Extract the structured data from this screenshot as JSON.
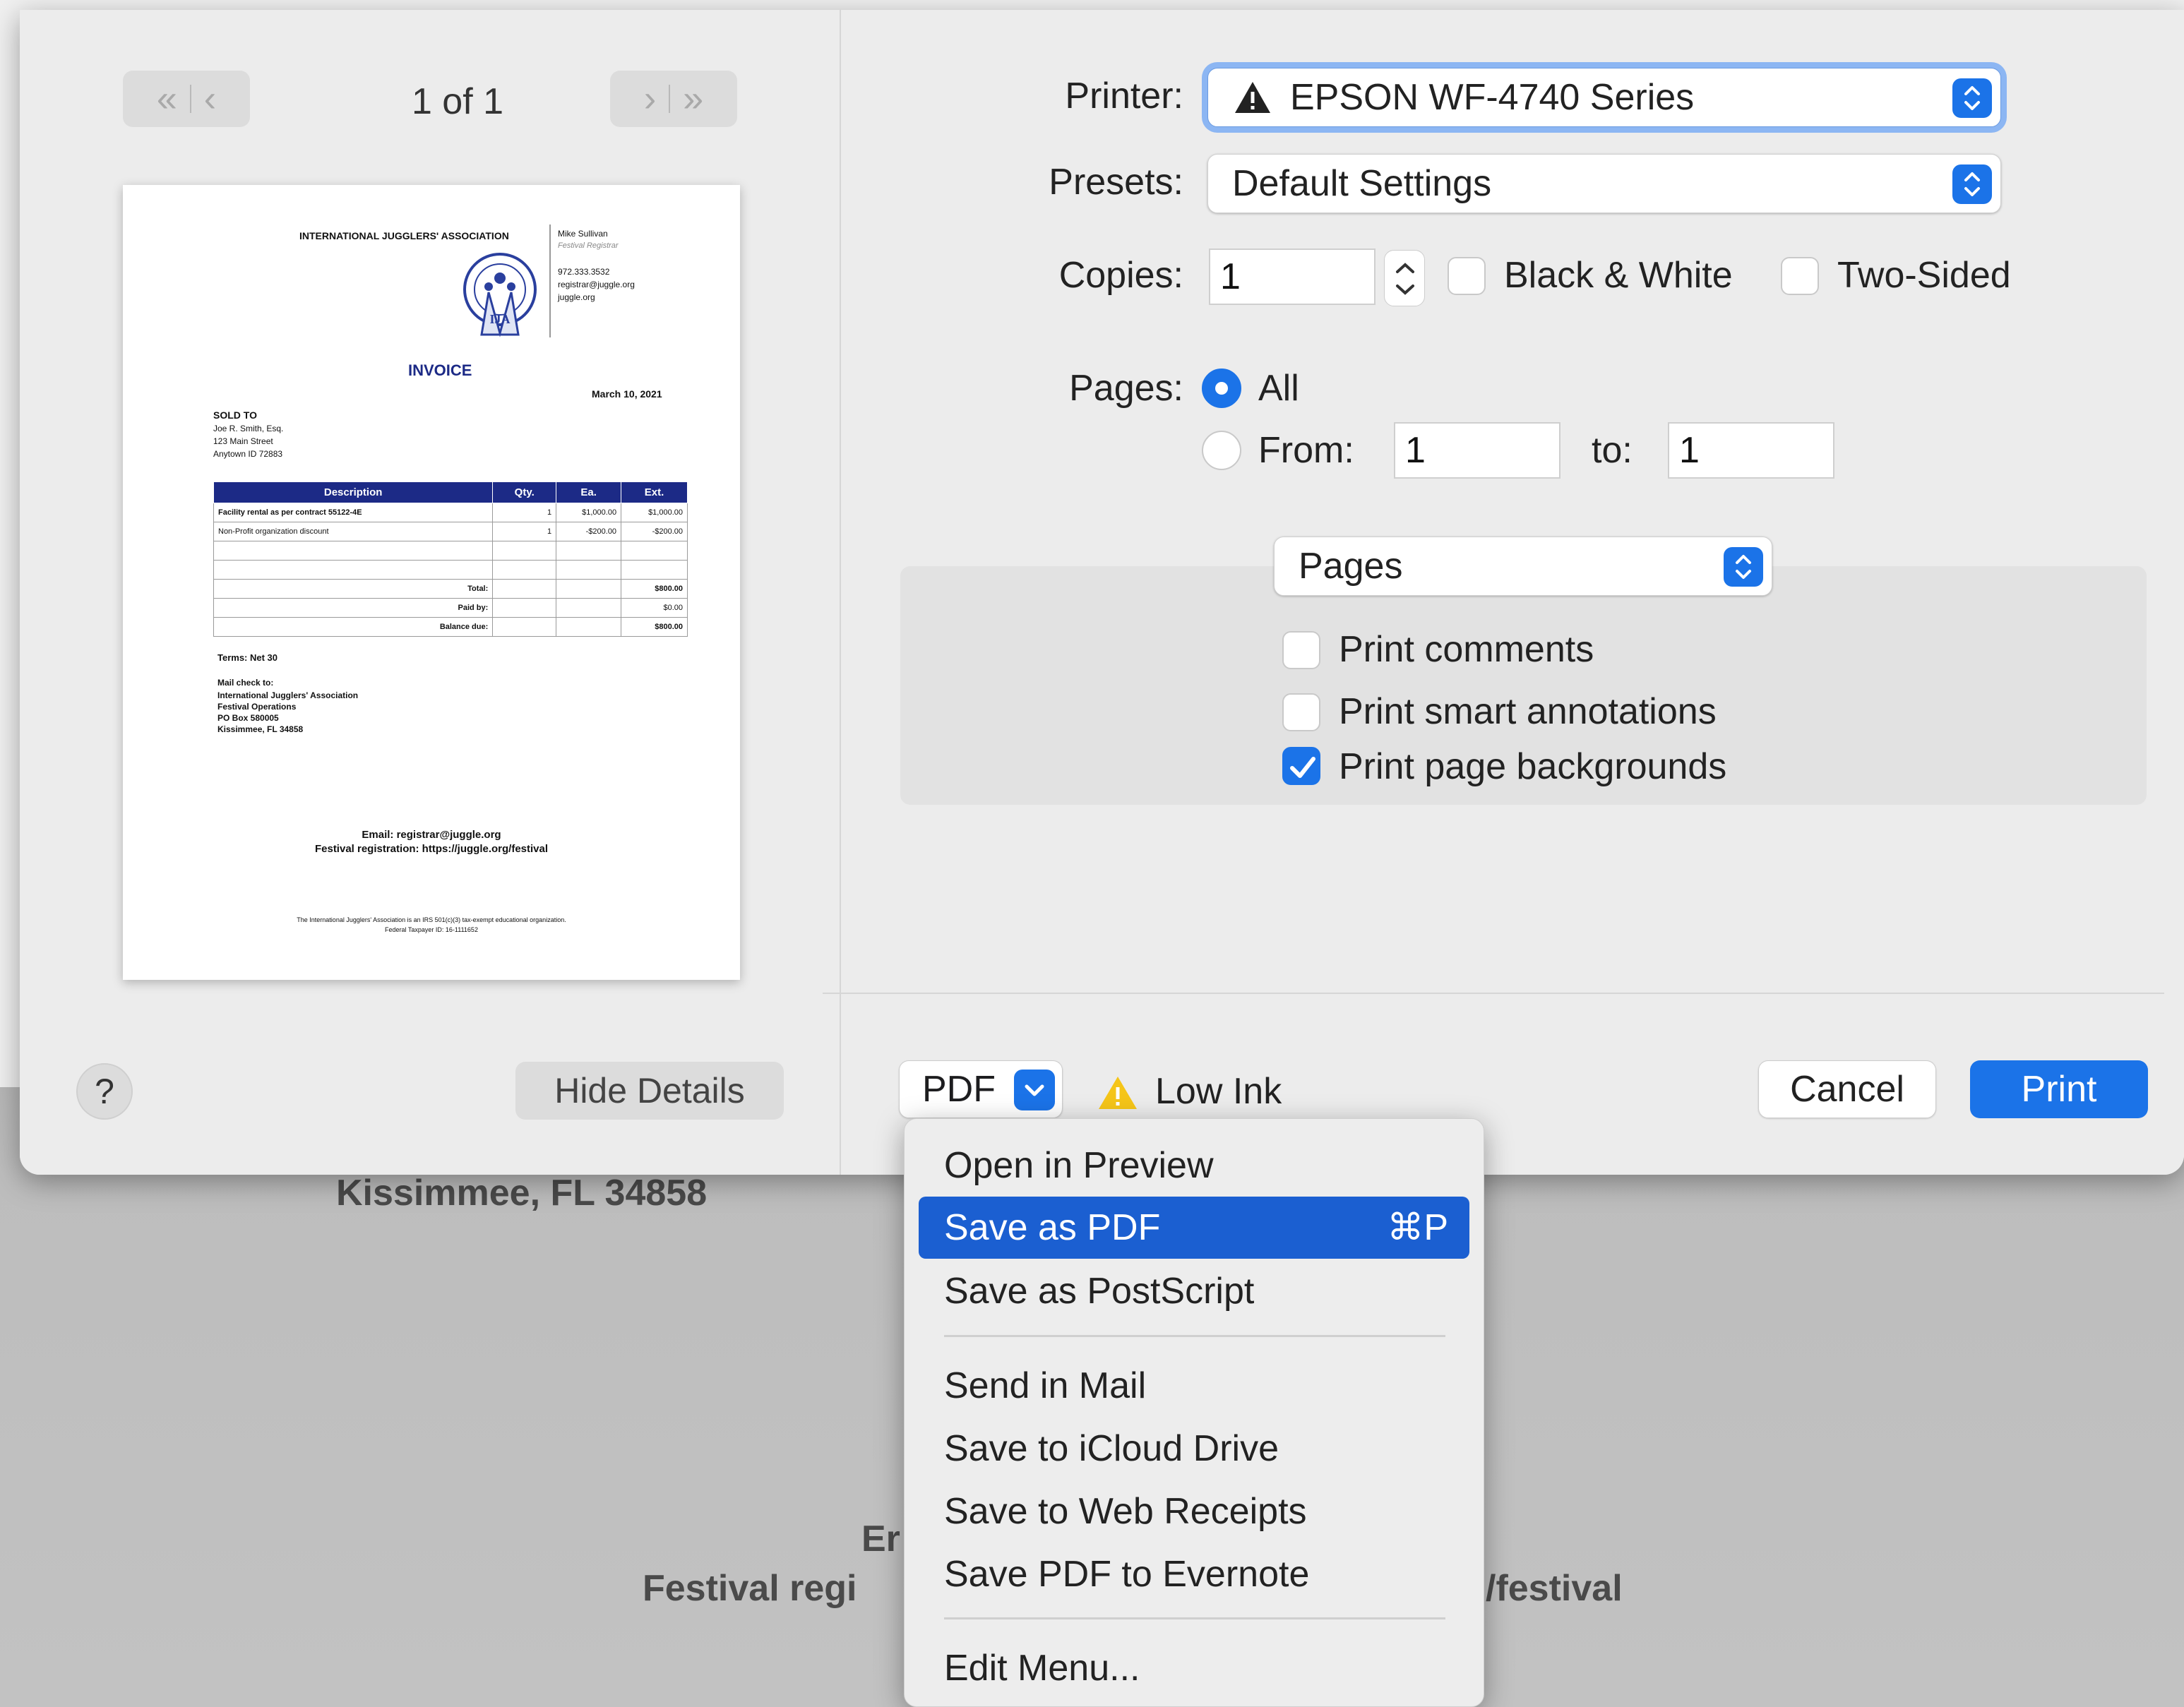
{
  "background_doc": {
    "city_line": "Kissimmee,   FL       34858",
    "email_fragment": "Er",
    "reg_fragment_left": "Festival regi",
    "reg_fragment_right": "/festival"
  },
  "preview": {
    "page_label": "1 of 1",
    "org_name": "INTERNATIONAL JUGGLERS' ASSOCIATION",
    "contact_name": "Mike Sullivan",
    "contact_title": "Festival Registrar",
    "contact_phone": "972.333.3532",
    "contact_email": "registrar@juggle.org",
    "contact_web": "juggle.org",
    "logo_text": "IJA",
    "invoice_title": "INVOICE",
    "date": "March 10, 2021",
    "sold_to_label": "SOLD TO",
    "sold_to_name": "Joe R. Smith, Esq.",
    "sold_to_street": "123 Main Street",
    "sold_to_city": "Anytown     ID     72883",
    "table_headers": [
      "Description",
      "Qty.",
      "Ea.",
      "Ext."
    ],
    "table_rows": [
      {
        "desc": "Facility rental as per contract 55122-4E",
        "qty": "1",
        "ea": "$1,000.00",
        "ext": "$1,000.00"
      },
      {
        "desc": "Non-Profit organization discount",
        "qty": "1",
        "ea": "-$200.00",
        "ext": "-$200.00"
      }
    ],
    "total_label": "Total:",
    "total_value": "$800.00",
    "paid_label": "Paid by:",
    "paid_value": "$0.00",
    "balance_label": "Balance due:",
    "balance_value": "$800.00",
    "terms": "Terms: Net 30",
    "mail_check": "Mail check to:",
    "mail_org": "International Jugglers' Association",
    "mail_dept": "Festival Operations",
    "mail_box": "PO Box 580005",
    "mail_city": "Kissimmee,  FL     34858",
    "footer_email": "Email: registrar@juggle.org",
    "footer_reg": "Festival registration: https://juggle.org/festival",
    "fine_print_1": "The International Jugglers' Association is an IRS 501(c)(3) tax-exempt educational organization.",
    "fine_print_2": "Federal Taxpayer ID: 16-1111652"
  },
  "left": {
    "help_label": "?",
    "hide_details": "Hide Details"
  },
  "form": {
    "printer_label": "Printer:",
    "printer_value": "EPSON WF-4740 Series",
    "presets_label": "Presets:",
    "presets_value": "Default Settings",
    "copies_label": "Copies:",
    "copies_value": "1",
    "bw_label": "Black & White",
    "two_sided_label": "Two-Sided",
    "pages_label": "Pages:",
    "all_label": "All",
    "from_label": "From:",
    "from_value": "1",
    "to_label": "to:",
    "to_value": "1",
    "section_value": "Pages",
    "print_comments": "Print comments",
    "print_smart": "Print smart annotations",
    "print_backgrounds": "Print page backgrounds"
  },
  "footer": {
    "pdf_label": "PDF",
    "low_ink": "Low Ink",
    "cancel": "Cancel",
    "print": "Print"
  },
  "pdf_menu": {
    "items": [
      {
        "label": "Open in Preview"
      },
      {
        "label": "Save as PDF",
        "shortcut": "⌘P"
      },
      {
        "label": "Save as PostScript"
      },
      {
        "label": "Send in Mail"
      },
      {
        "label": "Save to iCloud Drive"
      },
      {
        "label": "Save to Web Receipts"
      },
      {
        "label": "Save PDF to Evernote"
      },
      {
        "label": "Edit Menu..."
      }
    ]
  },
  "colors": {
    "accent": "#1b73e8",
    "menu_selected": "#1b5fd1",
    "invoice_header": "#1c2a86",
    "warning": "#f5c518"
  }
}
